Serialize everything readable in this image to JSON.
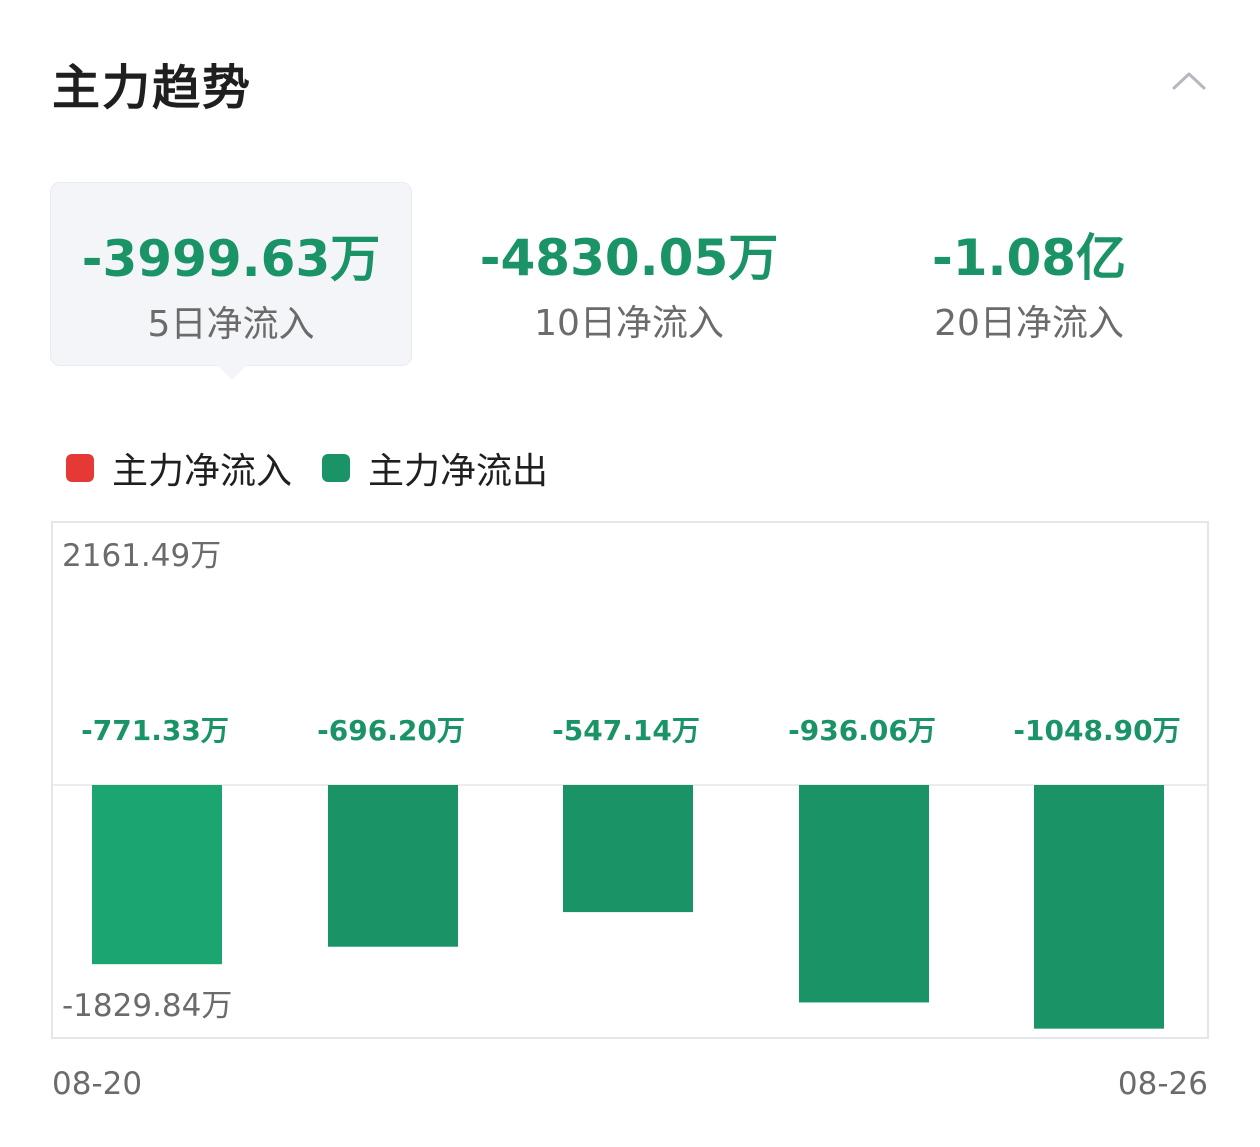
{
  "header": {
    "title": "主力趋势",
    "collapse_icon": "chevron-up-icon"
  },
  "tabs": [
    {
      "value": "-3999.63万",
      "label": "5日净流入",
      "active": true
    },
    {
      "value": "-4830.05万",
      "label": "10日净流入",
      "active": false
    },
    {
      "value": "-1.08亿",
      "label": "20日净流入",
      "active": false
    }
  ],
  "legend": [
    {
      "label": "主力净流入",
      "color": "#e53935"
    },
    {
      "label": "主力净流出",
      "color": "#1a9467"
    }
  ],
  "chart_data": {
    "type": "bar",
    "categories": [
      "08-20",
      "",
      "",
      "",
      "08-26"
    ],
    "values": [
      -771.33,
      -696.2,
      -547.14,
      -936.06,
      -1048.9
    ],
    "value_labels": [
      "-771.33万",
      "-696.20万",
      "-547.14万",
      "-936.06万",
      "-1048.90万"
    ],
    "ylim": [
      -1829.84,
      2161.49
    ],
    "ymax_label": "2161.49万",
    "ymin_label": "-1829.84万",
    "x_start_label": "08-20",
    "x_end_label": "08-26",
    "positive_color": "#e53935",
    "negative_color": "#1a9467",
    "first_bar_color": "#1ba571"
  }
}
